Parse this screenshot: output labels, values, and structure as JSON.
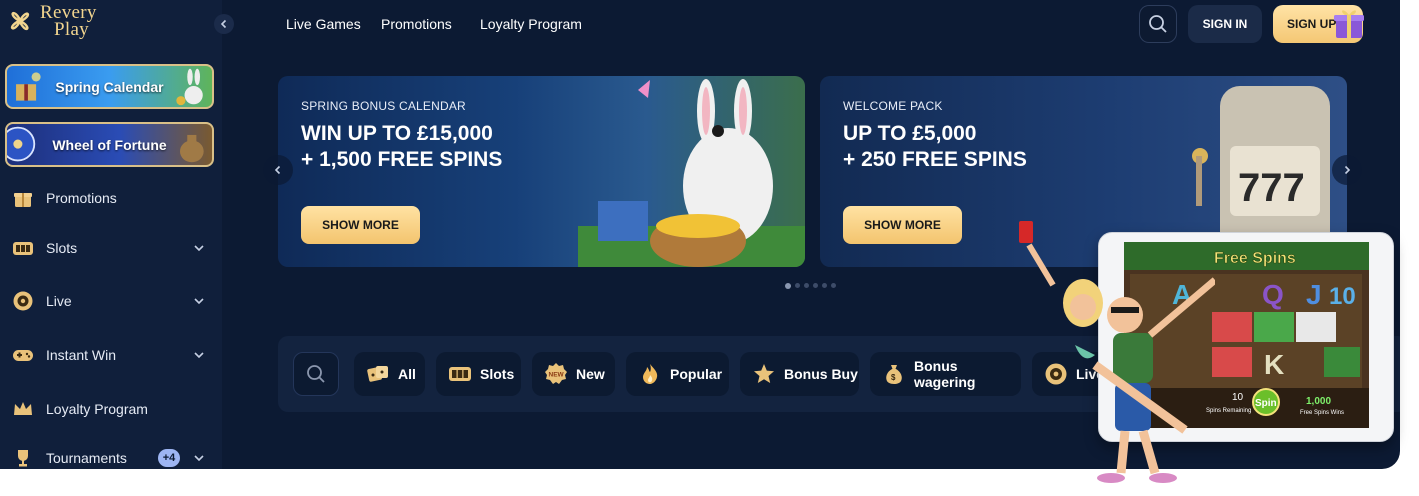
{
  "brand": {
    "name_line1": "Revery",
    "name_line2": "Play"
  },
  "sidebar": {
    "promos": [
      {
        "label": "Spring Calendar"
      },
      {
        "label": "Wheel of Fortune"
      }
    ],
    "items": [
      {
        "label": "Promotions",
        "icon": "gift-icon"
      },
      {
        "label": "Slots",
        "icon": "slot-machine-icon",
        "expandable": true
      },
      {
        "label": "Live",
        "icon": "roulette-icon",
        "expandable": true
      },
      {
        "label": "Instant Win",
        "icon": "gamepad-icon",
        "expandable": true
      },
      {
        "label": "Loyalty Program",
        "icon": "crown-icon"
      },
      {
        "label": "Tournaments",
        "icon": "trophy-icon",
        "expandable": true,
        "badge": "+4"
      }
    ]
  },
  "header": {
    "nav": [
      "Live Games",
      "Promotions",
      "Loyalty Program"
    ],
    "signin_label": "SIGN IN",
    "signup_label": "SIGN UP"
  },
  "banners": [
    {
      "eyebrow": "SPRING BONUS CALENDAR",
      "headline_line1": "WIN UP TO £15,000",
      "headline_line2": "+ 1,500 FREE SPINS",
      "cta": "SHOW MORE"
    },
    {
      "eyebrow": "WELCOME PACK",
      "headline_line1": "UP TO £5,000",
      "headline_line2": "+ 250 FREE SPINS",
      "cta": "SHOW MORE"
    }
  ],
  "carousel": {
    "slide_count": 6,
    "active_index": 0
  },
  "categories": [
    {
      "label": "All",
      "icon": "dice-icon"
    },
    {
      "label": "Slots",
      "icon": "slot-machine-icon"
    },
    {
      "label": "New",
      "icon": "new-badge-icon"
    },
    {
      "label": "Popular",
      "icon": "flame-icon"
    },
    {
      "label": "Bonus Buy",
      "icon": "star-icon"
    },
    {
      "label": "Bonus wagering",
      "icon": "money-bag-icon"
    },
    {
      "label": "Live",
      "icon": "roulette-icon"
    }
  ],
  "tablet_game": {
    "title": "Free Spins",
    "spins_remaining_value": "10",
    "spins_remaining_label": "Spins Remaining",
    "spin_label": "Spin",
    "free_spins_wins_value": "1,000",
    "free_spins_wins_label": "Free Spins Wins"
  },
  "colors": {
    "background": "#0c1a33",
    "sidebar": "#101f3b",
    "accent_gold": "#f4c774",
    "chip_bg": "#0c1a31"
  }
}
